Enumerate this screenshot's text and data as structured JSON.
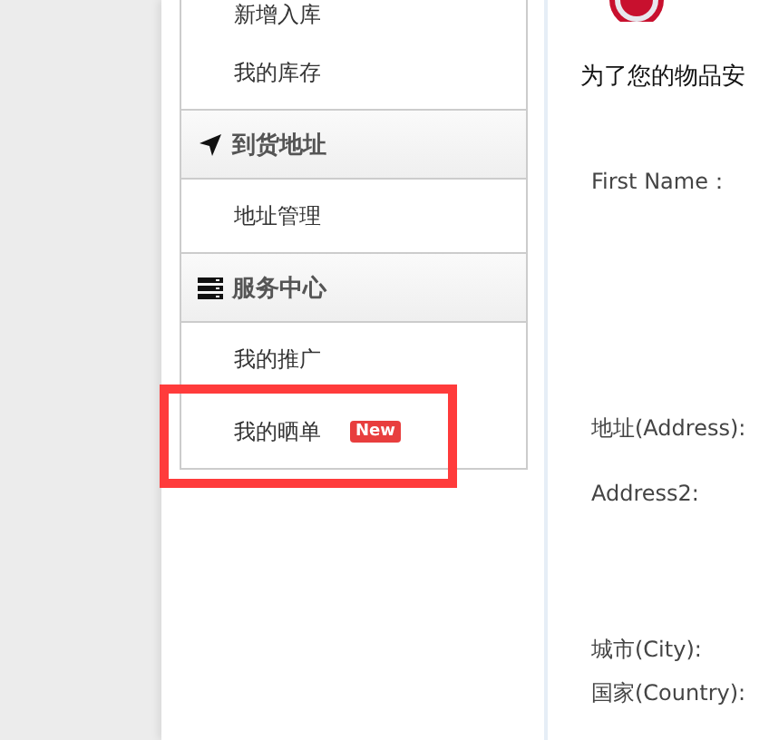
{
  "sidebar": {
    "sections": [
      {
        "kind": "items",
        "items": [
          {
            "label": "新增入库",
            "highlighted": false
          },
          {
            "label": "我的库存",
            "highlighted": false
          }
        ]
      },
      {
        "kind": "group",
        "title": "到货地址",
        "items": [
          {
            "label": "地址管理",
            "highlighted": false
          }
        ]
      },
      {
        "kind": "group",
        "title": "服务中心",
        "items": [
          {
            "label": "我的推广",
            "highlighted": false
          },
          {
            "label": "我的晒单",
            "badge": "New",
            "highlighted": true
          }
        ]
      }
    ]
  },
  "form": {
    "notice": "为了您的物品安",
    "fields": [
      {
        "label": "First Name："
      },
      {
        "label": "地址(Address):"
      },
      {
        "label": "Address2:"
      },
      {
        "label": "城市(City):"
      },
      {
        "label": "国家(Country):"
      }
    ]
  }
}
